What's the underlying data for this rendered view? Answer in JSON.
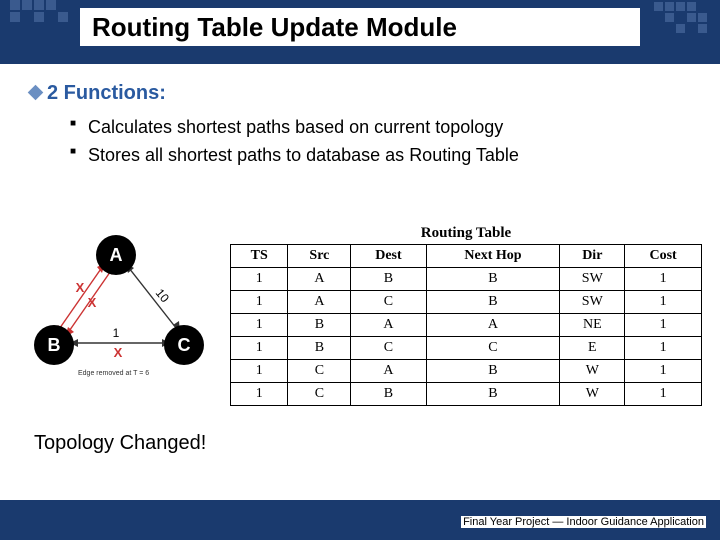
{
  "slide": {
    "title": "Routing Table Update Module",
    "heading": "2 Functions:",
    "bullets": [
      "Calculates shortest paths based on current topology",
      "Stores all shortest paths to database as Routing Table"
    ],
    "topology_label": "Topology Changed!",
    "footer": "Final Year Project — Indoor Guidance Application"
  },
  "graph": {
    "nodes": {
      "A": "A",
      "B": "B",
      "C": "C"
    },
    "edge_AB_x1": "X",
    "edge_AB_x2": "X",
    "edge_AC_w": "10",
    "edge_BC_w": "1",
    "edge_BC_x": "X",
    "note": "Edge removed at T = 6"
  },
  "routing_table": {
    "title": "Routing Table",
    "headers": [
      "TS",
      "Src",
      "Dest",
      "Next Hop",
      "Dir",
      "Cost"
    ],
    "rows": [
      [
        "1",
        "A",
        "B",
        "B",
        "SW",
        "1"
      ],
      [
        "1",
        "A",
        "C",
        "B",
        "SW",
        "1"
      ],
      [
        "1",
        "B",
        "A",
        "A",
        "NE",
        "1"
      ],
      [
        "1",
        "B",
        "C",
        "C",
        "E",
        "1"
      ],
      [
        "1",
        "C",
        "A",
        "B",
        "W",
        "1"
      ],
      [
        "1",
        "C",
        "B",
        "B",
        "W",
        "1"
      ]
    ]
  }
}
